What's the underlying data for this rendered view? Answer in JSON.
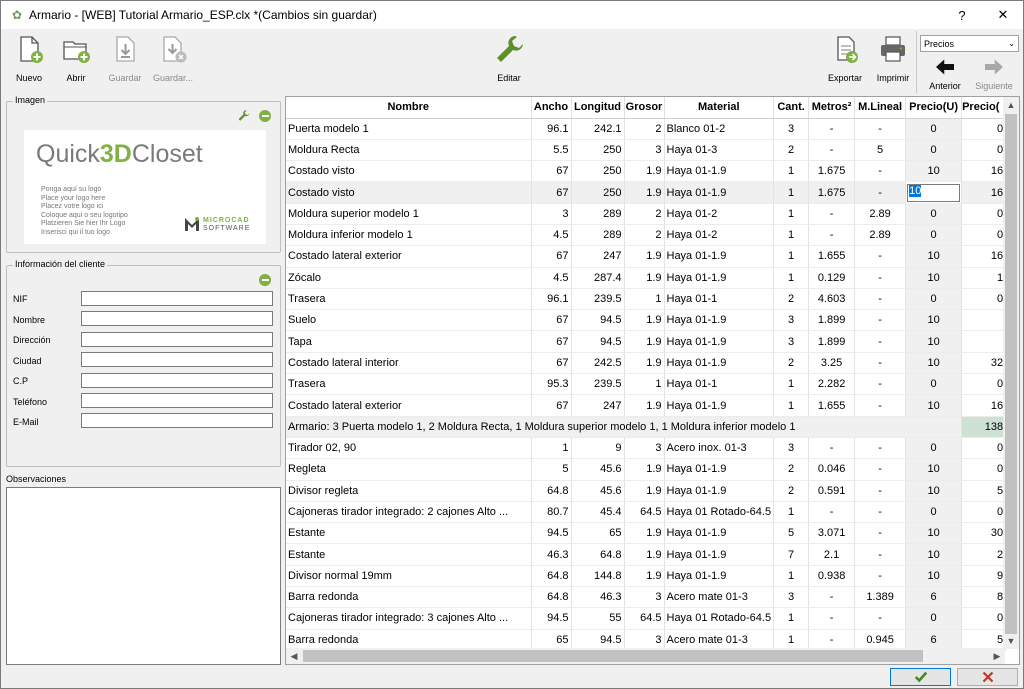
{
  "window": {
    "title": "Armario - [WEB] Tutorial Armario_ESP.clx *(Cambios sin guardar)",
    "help": "?",
    "close": "✕"
  },
  "toolbar": {
    "nuevo": "Nuevo",
    "abrir": "Abrir",
    "guardar": "Guardar",
    "guardar_como": "Guardar...",
    "editar": "Editar",
    "exportar": "Exportar",
    "imprimir": "Imprimir",
    "precios": "Precios",
    "anterior": "Anterior",
    "siguiente": "Siguiente"
  },
  "imagen": {
    "title": "Imagen",
    "logo_text_a": "Quick",
    "logo_text_b": "3D",
    "logo_text_c": "Closet",
    "logo_lines": [
      "Ponga aquí su logo",
      "Place your logo here",
      "Placez votre logo ici",
      "Coloque aqui o seu logotipo",
      "Platzieren Sie hier Ihr Logo",
      "Inserisci qui il tuo logo"
    ],
    "brand_top": "MICROCAD",
    "brand_bottom": "SOFTWARE"
  },
  "cliente": {
    "title": "Información del cliente",
    "fields": [
      {
        "label": "NIF",
        "value": ""
      },
      {
        "label": "Nombre",
        "value": ""
      },
      {
        "label": "Dirección",
        "value": ""
      },
      {
        "label": "Ciudad",
        "value": ""
      },
      {
        "label": "C.P",
        "value": ""
      },
      {
        "label": "Teléfono",
        "value": ""
      },
      {
        "label": "E-Mail",
        "value": ""
      }
    ]
  },
  "observaciones": {
    "title": "Observaciones",
    "value": ""
  },
  "grid": {
    "headers": [
      "Nombre",
      "Ancho",
      "Longitud",
      "Grosor",
      "Material",
      "Cant.",
      "Metros²",
      "M.Lineal",
      "Precio(U)",
      "Precio("
    ],
    "rows": [
      [
        "Puerta modelo 1",
        "96.1",
        "242.1",
        "2",
        "Blanco 01-2",
        "3",
        "-",
        "-",
        "0",
        "0"
      ],
      [
        "Moldura Recta",
        "5.5",
        "250",
        "3",
        "Haya 01-3",
        "2",
        "-",
        "5",
        "0",
        "0"
      ],
      [
        "Costado visto",
        "67",
        "250",
        "1.9",
        "Haya 01-1.9",
        "1",
        "1.675",
        "-",
        "10",
        "16"
      ],
      [
        "Costado visto",
        "67",
        "250",
        "1.9",
        "Haya 01-1.9",
        "1",
        "1.675",
        "-",
        "10",
        "16"
      ],
      [
        "Moldura superior modelo 1",
        "3",
        "289",
        "2",
        "Haya 01-2",
        "1",
        "-",
        "2.89",
        "0",
        "0"
      ],
      [
        "Moldura inferior modelo 1",
        "4.5",
        "289",
        "2",
        "Haya 01-2",
        "1",
        "-",
        "2.89",
        "0",
        "0"
      ],
      [
        "Costado lateral exterior",
        "67",
        "247",
        "1.9",
        "Haya 01-1.9",
        "1",
        "1.655",
        "-",
        "10",
        "16"
      ],
      [
        "Zócalo",
        "4.5",
        "287.4",
        "1.9",
        "Haya 01-1.9",
        "1",
        "0.129",
        "-",
        "10",
        "1"
      ],
      [
        "Trasera",
        "96.1",
        "239.5",
        "1",
        "Haya 01-1",
        "2",
        "4.603",
        "-",
        "0",
        "0"
      ],
      [
        "Suelo",
        "67",
        "94.5",
        "1.9",
        "Haya 01-1.9",
        "3",
        "1.899",
        "-",
        "10",
        ""
      ],
      [
        "Tapa",
        "67",
        "94.5",
        "1.9",
        "Haya 01-1.9",
        "3",
        "1.899",
        "-",
        "10",
        ""
      ],
      [
        "Costado lateral interior",
        "67",
        "242.5",
        "1.9",
        "Haya 01-1.9",
        "2",
        "3.25",
        "-",
        "10",
        "32"
      ],
      [
        "Trasera",
        "95.3",
        "239.5",
        "1",
        "Haya 01-1",
        "1",
        "2.282",
        "-",
        "0",
        "0"
      ],
      [
        "Costado lateral exterior",
        "67",
        "247",
        "1.9",
        "Haya 01-1.9",
        "1",
        "1.655",
        "-",
        "10",
        "16"
      ]
    ],
    "summary_text": "Armario: 3 Puerta modelo 1, 2 Moldura Recta, 1 Moldura superior modelo 1, 1 Moldura inferior modelo 1",
    "summary_value": "138",
    "rows2": [
      [
        "Tirador 02, 90",
        "1",
        "9",
        "3",
        "Acero inox. 01-3",
        "3",
        "-",
        "-",
        "0",
        "0"
      ],
      [
        "Regleta",
        "5",
        "45.6",
        "1.9",
        "Haya 01-1.9",
        "2",
        "0.046",
        "-",
        "10",
        "0"
      ],
      [
        "Divisor regleta",
        "64.8",
        "45.6",
        "1.9",
        "Haya 01-1.9",
        "2",
        "0.591",
        "-",
        "10",
        "5"
      ],
      [
        "Cajoneras tirador integrado: 2 cajones Alto ...",
        "80.7",
        "45.4",
        "64.5",
        "Haya 01 Rotado-64.5",
        "1",
        "-",
        "-",
        "0",
        "0"
      ],
      [
        "Estante",
        "94.5",
        "65",
        "1.9",
        "Haya 01-1.9",
        "5",
        "3.071",
        "-",
        "10",
        "30"
      ],
      [
        "Estante",
        "46.3",
        "64.8",
        "1.9",
        "Haya 01-1.9",
        "7",
        "2.1",
        "-",
        "10",
        "2"
      ],
      [
        "Divisor normal 19mm",
        "64.8",
        "144.8",
        "1.9",
        "Haya 01-1.9",
        "1",
        "0.938",
        "-",
        "10",
        "9"
      ],
      [
        "Barra redonda",
        "64.8",
        "46.3",
        "3",
        "Acero mate 01-3",
        "3",
        "-",
        "1.389",
        "6",
        "8"
      ],
      [
        "Cajoneras tirador integrado: 3 cajones Alto ...",
        "94.5",
        "55",
        "64.5",
        "Haya 01 Rotado-64.5",
        "1",
        "-",
        "-",
        "0",
        "0"
      ],
      [
        "Barra redonda",
        "65",
        "94.5",
        "3",
        "Acero mate 01-3",
        "1",
        "-",
        "0.945",
        "6",
        "5"
      ]
    ],
    "edit_value": "10"
  },
  "colors": {
    "accent_green": "#7fb143",
    "selection_blue": "#0078d7",
    "cancel_red": "#c0392b"
  }
}
